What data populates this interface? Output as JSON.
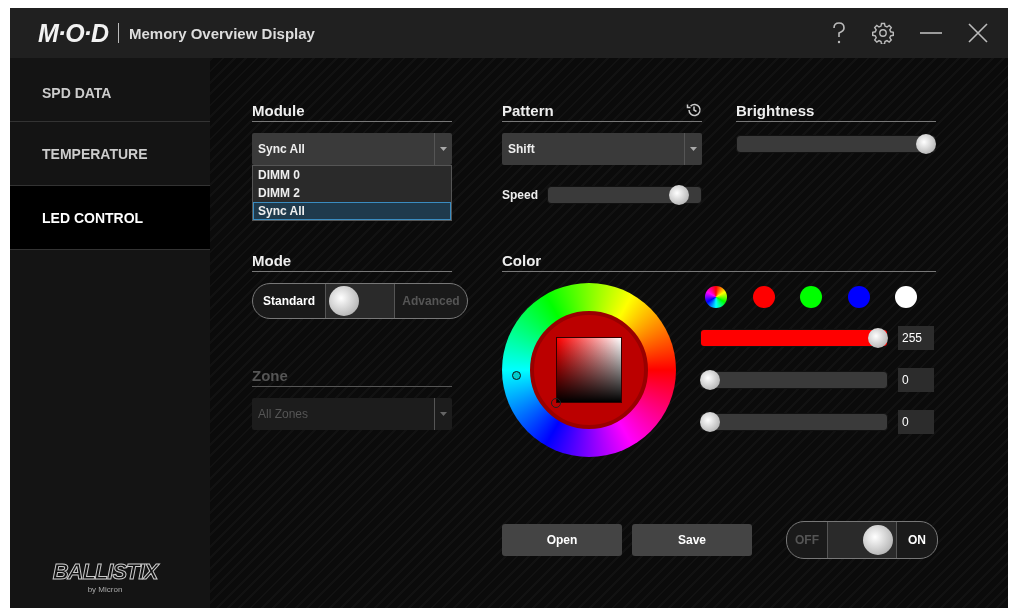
{
  "window": {
    "logo": "M·O·D",
    "title": "Memory Overview Display"
  },
  "sidebar": {
    "items": [
      {
        "label": "SPD DATA",
        "selected": false
      },
      {
        "label": "TEMPERATURE",
        "selected": false
      },
      {
        "label": "LED CONTROL",
        "selected": true
      }
    ],
    "brand": {
      "name": "BALLISTIX",
      "tagline": "by Micron"
    }
  },
  "module": {
    "heading": "Module",
    "value": "Sync All",
    "options": [
      {
        "label": "DIMM 0",
        "selected": false
      },
      {
        "label": "DIMM 2",
        "selected": false
      },
      {
        "label": "Sync All",
        "selected": true
      }
    ]
  },
  "pattern": {
    "heading": "Pattern",
    "value": "Shift",
    "speed": {
      "label": "Speed",
      "level": 0.9
    }
  },
  "brightness": {
    "heading": "Brightness",
    "level": 1
  },
  "mode": {
    "heading": "Mode",
    "options": [
      {
        "label": "Standard",
        "selected": true
      },
      {
        "label": "Advanced",
        "selected": false
      }
    ]
  },
  "zone": {
    "heading": "Zone",
    "value": "All Zones",
    "disabled": true
  },
  "color": {
    "heading": "Color",
    "swatches": [
      {
        "kind": "spectrum"
      },
      {
        "kind": "solid",
        "color": "#ff0000"
      },
      {
        "kind": "solid",
        "color": "#00ff00"
      },
      {
        "kind": "solid",
        "color": "#0000ff"
      },
      {
        "kind": "solid",
        "color": "#ffffff"
      }
    ],
    "channels": [
      {
        "level": 1,
        "value": "255"
      },
      {
        "level": 0,
        "value": "0"
      },
      {
        "level": 0,
        "value": "0"
      }
    ]
  },
  "buttons": [
    {
      "label": "Open"
    },
    {
      "label": "Save"
    }
  ],
  "power": {
    "off_label": "OFF",
    "on_label": "ON",
    "on": true
  }
}
